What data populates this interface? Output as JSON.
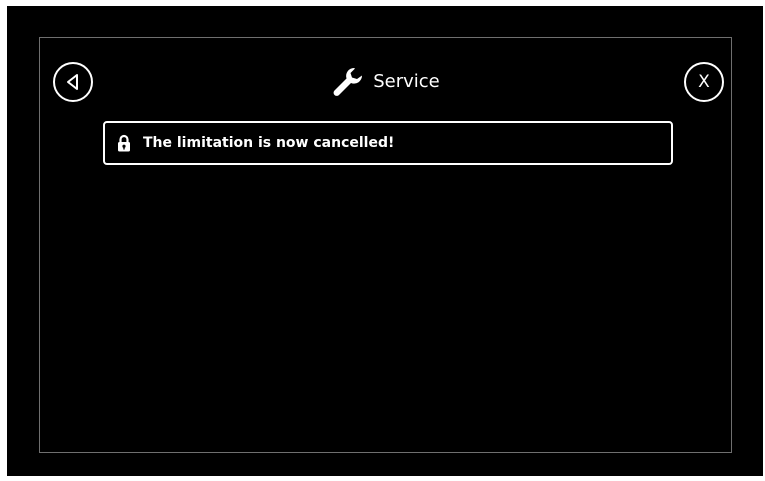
{
  "header": {
    "title": "Service",
    "title_icon": "wrench-icon",
    "back_icon": "back-arrow-icon",
    "close_label": "X"
  },
  "notice": {
    "icon": "lock-icon",
    "message": "The limitation is now cancelled!"
  },
  "colors": {
    "background": "#000000",
    "foreground": "#ffffff",
    "frame_border": "#6f6f6f"
  }
}
